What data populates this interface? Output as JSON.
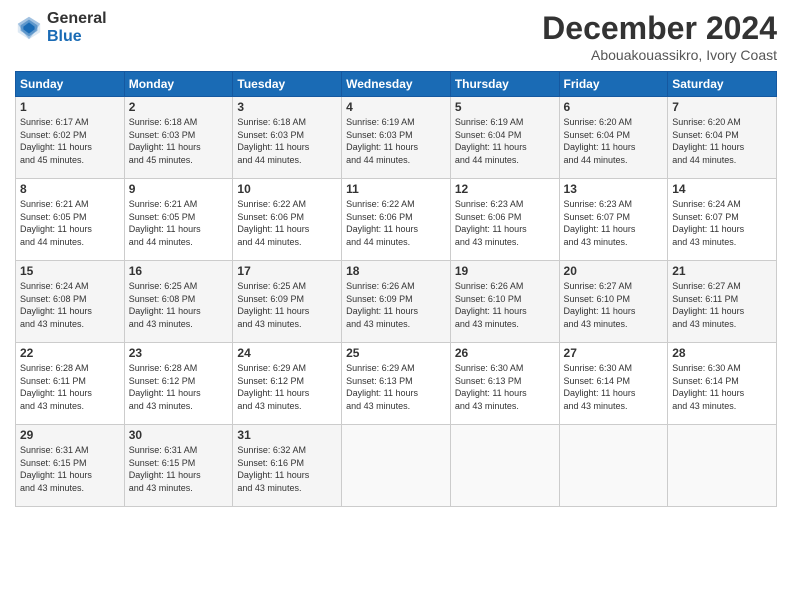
{
  "logo": {
    "general": "General",
    "blue": "Blue"
  },
  "title": "December 2024",
  "location": "Abouakouassikro, Ivory Coast",
  "weekdays": [
    "Sunday",
    "Monday",
    "Tuesday",
    "Wednesday",
    "Thursday",
    "Friday",
    "Saturday"
  ],
  "weeks": [
    [
      {
        "day": "1",
        "sunrise": "6:17 AM",
        "sunset": "6:02 PM",
        "daylight": "11 hours and 45 minutes."
      },
      {
        "day": "2",
        "sunrise": "6:18 AM",
        "sunset": "6:03 PM",
        "daylight": "11 hours and 45 minutes."
      },
      {
        "day": "3",
        "sunrise": "6:18 AM",
        "sunset": "6:03 PM",
        "daylight": "11 hours and 44 minutes."
      },
      {
        "day": "4",
        "sunrise": "6:19 AM",
        "sunset": "6:03 PM",
        "daylight": "11 hours and 44 minutes."
      },
      {
        "day": "5",
        "sunrise": "6:19 AM",
        "sunset": "6:04 PM",
        "daylight": "11 hours and 44 minutes."
      },
      {
        "day": "6",
        "sunrise": "6:20 AM",
        "sunset": "6:04 PM",
        "daylight": "11 hours and 44 minutes."
      },
      {
        "day": "7",
        "sunrise": "6:20 AM",
        "sunset": "6:04 PM",
        "daylight": "11 hours and 44 minutes."
      }
    ],
    [
      {
        "day": "8",
        "sunrise": "6:21 AM",
        "sunset": "6:05 PM",
        "daylight": "11 hours and 44 minutes."
      },
      {
        "day": "9",
        "sunrise": "6:21 AM",
        "sunset": "6:05 PM",
        "daylight": "11 hours and 44 minutes."
      },
      {
        "day": "10",
        "sunrise": "6:22 AM",
        "sunset": "6:06 PM",
        "daylight": "11 hours and 44 minutes."
      },
      {
        "day": "11",
        "sunrise": "6:22 AM",
        "sunset": "6:06 PM",
        "daylight": "11 hours and 44 minutes."
      },
      {
        "day": "12",
        "sunrise": "6:23 AM",
        "sunset": "6:06 PM",
        "daylight": "11 hours and 43 minutes."
      },
      {
        "day": "13",
        "sunrise": "6:23 AM",
        "sunset": "6:07 PM",
        "daylight": "11 hours and 43 minutes."
      },
      {
        "day": "14",
        "sunrise": "6:24 AM",
        "sunset": "6:07 PM",
        "daylight": "11 hours and 43 minutes."
      }
    ],
    [
      {
        "day": "15",
        "sunrise": "6:24 AM",
        "sunset": "6:08 PM",
        "daylight": "11 hours and 43 minutes."
      },
      {
        "day": "16",
        "sunrise": "6:25 AM",
        "sunset": "6:08 PM",
        "daylight": "11 hours and 43 minutes."
      },
      {
        "day": "17",
        "sunrise": "6:25 AM",
        "sunset": "6:09 PM",
        "daylight": "11 hours and 43 minutes."
      },
      {
        "day": "18",
        "sunrise": "6:26 AM",
        "sunset": "6:09 PM",
        "daylight": "11 hours and 43 minutes."
      },
      {
        "day": "19",
        "sunrise": "6:26 AM",
        "sunset": "6:10 PM",
        "daylight": "11 hours and 43 minutes."
      },
      {
        "day": "20",
        "sunrise": "6:27 AM",
        "sunset": "6:10 PM",
        "daylight": "11 hours and 43 minutes."
      },
      {
        "day": "21",
        "sunrise": "6:27 AM",
        "sunset": "6:11 PM",
        "daylight": "11 hours and 43 minutes."
      }
    ],
    [
      {
        "day": "22",
        "sunrise": "6:28 AM",
        "sunset": "6:11 PM",
        "daylight": "11 hours and 43 minutes."
      },
      {
        "day": "23",
        "sunrise": "6:28 AM",
        "sunset": "6:12 PM",
        "daylight": "11 hours and 43 minutes."
      },
      {
        "day": "24",
        "sunrise": "6:29 AM",
        "sunset": "6:12 PM",
        "daylight": "11 hours and 43 minutes."
      },
      {
        "day": "25",
        "sunrise": "6:29 AM",
        "sunset": "6:13 PM",
        "daylight": "11 hours and 43 minutes."
      },
      {
        "day": "26",
        "sunrise": "6:30 AM",
        "sunset": "6:13 PM",
        "daylight": "11 hours and 43 minutes."
      },
      {
        "day": "27",
        "sunrise": "6:30 AM",
        "sunset": "6:14 PM",
        "daylight": "11 hours and 43 minutes."
      },
      {
        "day": "28",
        "sunrise": "6:30 AM",
        "sunset": "6:14 PM",
        "daylight": "11 hours and 43 minutes."
      }
    ],
    [
      {
        "day": "29",
        "sunrise": "6:31 AM",
        "sunset": "6:15 PM",
        "daylight": "11 hours and 43 minutes."
      },
      {
        "day": "30",
        "sunrise": "6:31 AM",
        "sunset": "6:15 PM",
        "daylight": "11 hours and 43 minutes."
      },
      {
        "day": "31",
        "sunrise": "6:32 AM",
        "sunset": "6:16 PM",
        "daylight": "11 hours and 43 minutes."
      },
      null,
      null,
      null,
      null
    ]
  ]
}
